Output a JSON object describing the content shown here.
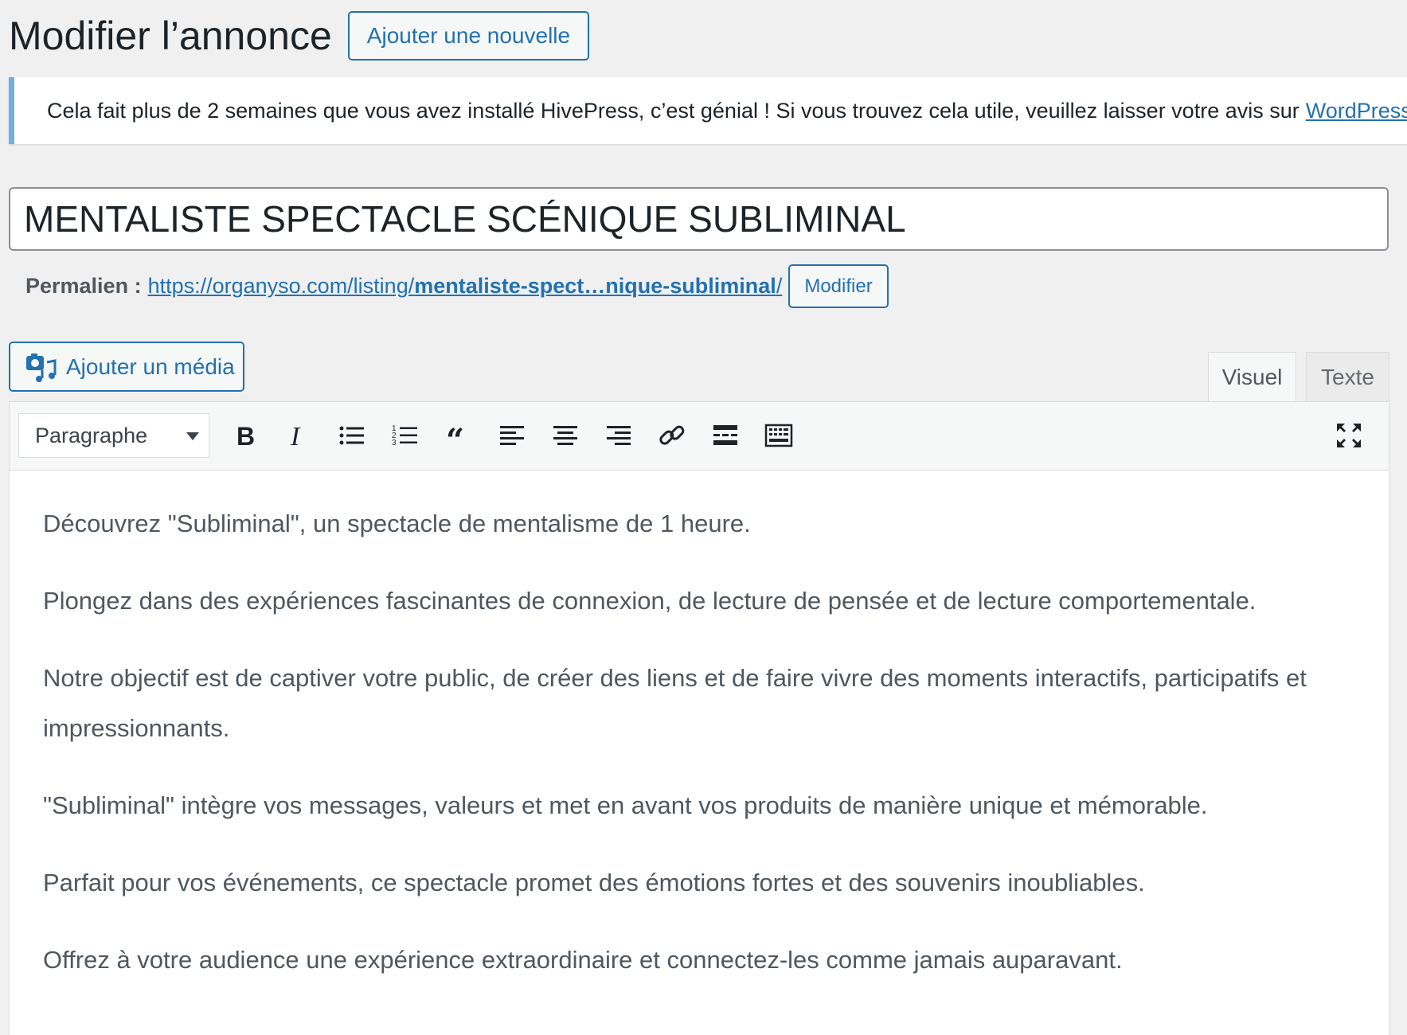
{
  "header": {
    "title": "Modifier l’annonce",
    "add_new_label": "Ajouter une nouvelle"
  },
  "notice": {
    "text": "Cela fait plus de 2 semaines que vous avez installé HivePress, c’est génial ! Si vous trouvez cela utile, veuillez laisser votre avis sur",
    "link_text": "WordPress"
  },
  "post": {
    "title": "MENTALISTE SPECTACLE SCÉNIQUE SUBLIMINAL"
  },
  "permalink": {
    "label": "Permalien :",
    "url_base": "https://organyso.com/listing/",
    "url_slug": "mentaliste-spect…nique-subliminal",
    "url_end": "/",
    "modify_label": "Modifier"
  },
  "media": {
    "label": "Ajouter un média",
    "icon": "add-media-icon"
  },
  "tabs": {
    "visual": "Visuel",
    "text": "Texte"
  },
  "toolbar": {
    "format_selected": "Paragraphe",
    "buttons": [
      "bold-icon",
      "italic-icon",
      "bullet-list-icon",
      "numbered-list-icon",
      "blockquote-icon",
      "align-left-icon",
      "align-center-icon",
      "align-right-icon",
      "link-icon",
      "read-more-icon",
      "toolbar-toggle-icon",
      "fullscreen-icon"
    ]
  },
  "content": {
    "paragraphs": [
      "Découvrez \"Subliminal\", un spectacle de mentalisme de 1 heure.",
      "Plongez dans des expériences fascinantes de connexion, de lecture de pensée et de lecture comportementale.",
      "Notre objectif est de captiver votre public, de créer des liens et de faire vivre des moments interactifs, participatifs et impressionnants.",
      "\"Subliminal\" intègre vos messages, valeurs et met en avant vos produits de manière unique et mémorable.",
      "Parfait pour vos événements, ce spectacle promet des émotions fortes et des souvenirs inoubliables.",
      "Offrez à votre audience une expérience extraordinaire et connectez-les comme jamais auparavant."
    ]
  },
  "colors": {
    "accent": "#2271b1",
    "notice_border": "#72aee6",
    "background": "#f0f0f1"
  }
}
